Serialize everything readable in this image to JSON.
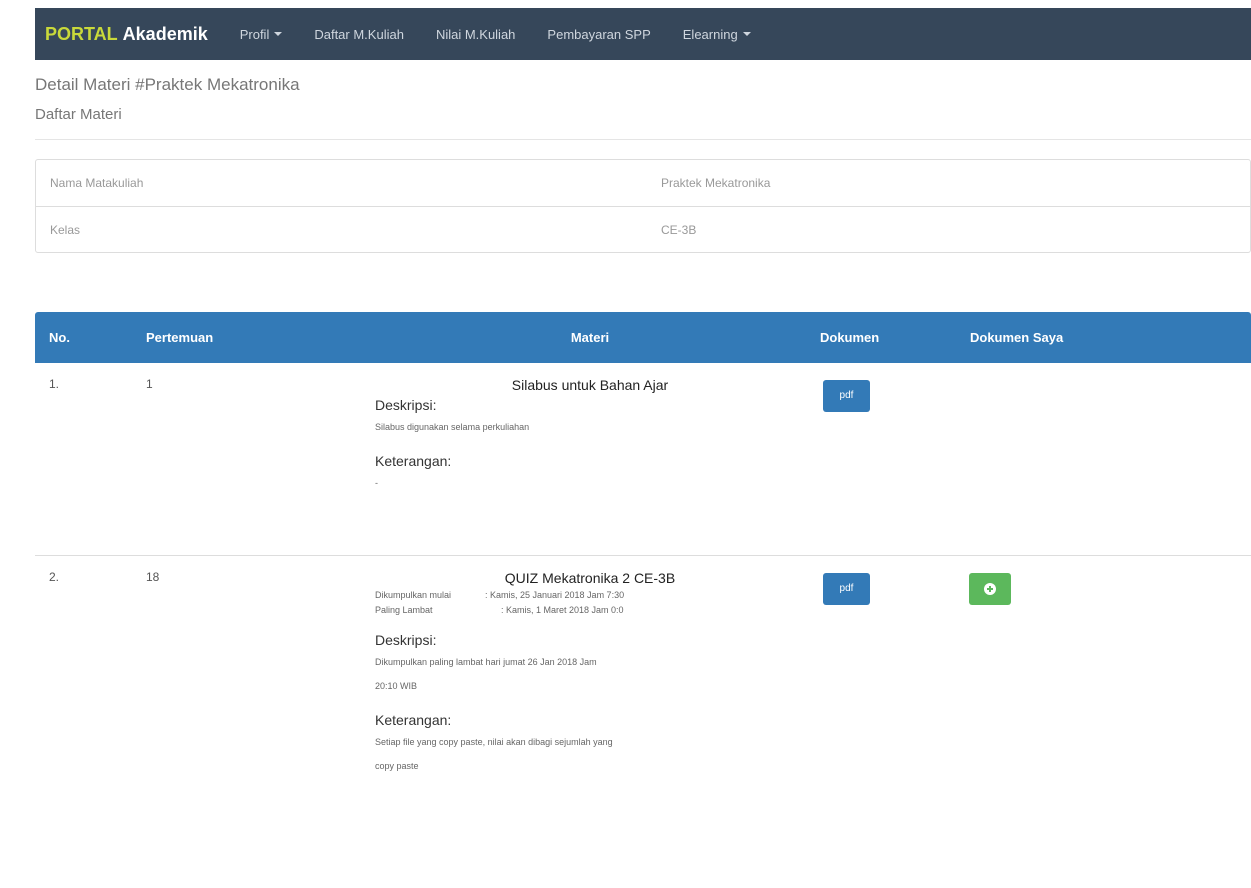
{
  "navbar": {
    "brand_part1": "PORTAL",
    "brand_part2": "Akademik",
    "items": [
      {
        "label": "Profil",
        "dropdown": true
      },
      {
        "label": "Daftar M.Kuliah",
        "dropdown": false
      },
      {
        "label": "Nilai M.Kuliah",
        "dropdown": false
      },
      {
        "label": "Pembayaran SPP",
        "dropdown": false
      },
      {
        "label": "Elearning",
        "dropdown": true
      }
    ]
  },
  "page": {
    "title": "Detail Materi #Praktek Mekatronika",
    "subtitle": "Daftar Materi"
  },
  "info": {
    "rows": [
      {
        "key": "Nama Matakuliah",
        "value": "Praktek Mekatronika"
      },
      {
        "key": "Kelas",
        "value": "CE-3B"
      }
    ]
  },
  "table": {
    "headers": [
      "No.",
      "Pertemuan",
      "Materi",
      "Dokumen",
      "Dokumen Saya"
    ],
    "rows": [
      {
        "no": "1.",
        "pertemuan": "1",
        "judul": "Silabus untuk Bahan Ajar",
        "deskripsi_label": "Deskripsi:",
        "deskripsi": "Silabus digunakan selama perkuliahan",
        "keterangan_label": "Keterangan:",
        "keterangan": "-",
        "dokumen_label": "pdf"
      },
      {
        "no": "2.",
        "pertemuan": "18",
        "judul": "QUIZ Mekatronika 2 CE-3B",
        "mulai_label": "Dikumpulkan mulai",
        "mulai_value": ": Kamis, 25 Januari 2018 Jam 7:30",
        "lambat_label": "Paling Lambat",
        "lambat_value": ": Kamis, 1 Maret 2018 Jam 0:0",
        "deskripsi_label": "Deskripsi:",
        "deskripsi_line1": "Dikumpulkan paling lambat hari jumat 26 Jan 2018 Jam",
        "deskripsi_line2": "20:10 WIB",
        "keterangan_label": "Keterangan:",
        "keterangan_line1": "Setiap file yang copy paste, nilai akan dibagi sejumlah yang",
        "keterangan_line2": "copy paste",
        "dokumen_label": "pdf"
      }
    ]
  },
  "colors": {
    "navbar": "#36475a",
    "brand_accent": "#c9d93a",
    "primary": "#337ab7",
    "success": "#5cb85c"
  },
  "icons": {
    "upload": "plus-circle-icon",
    "dropdown": "caret-down-icon"
  }
}
